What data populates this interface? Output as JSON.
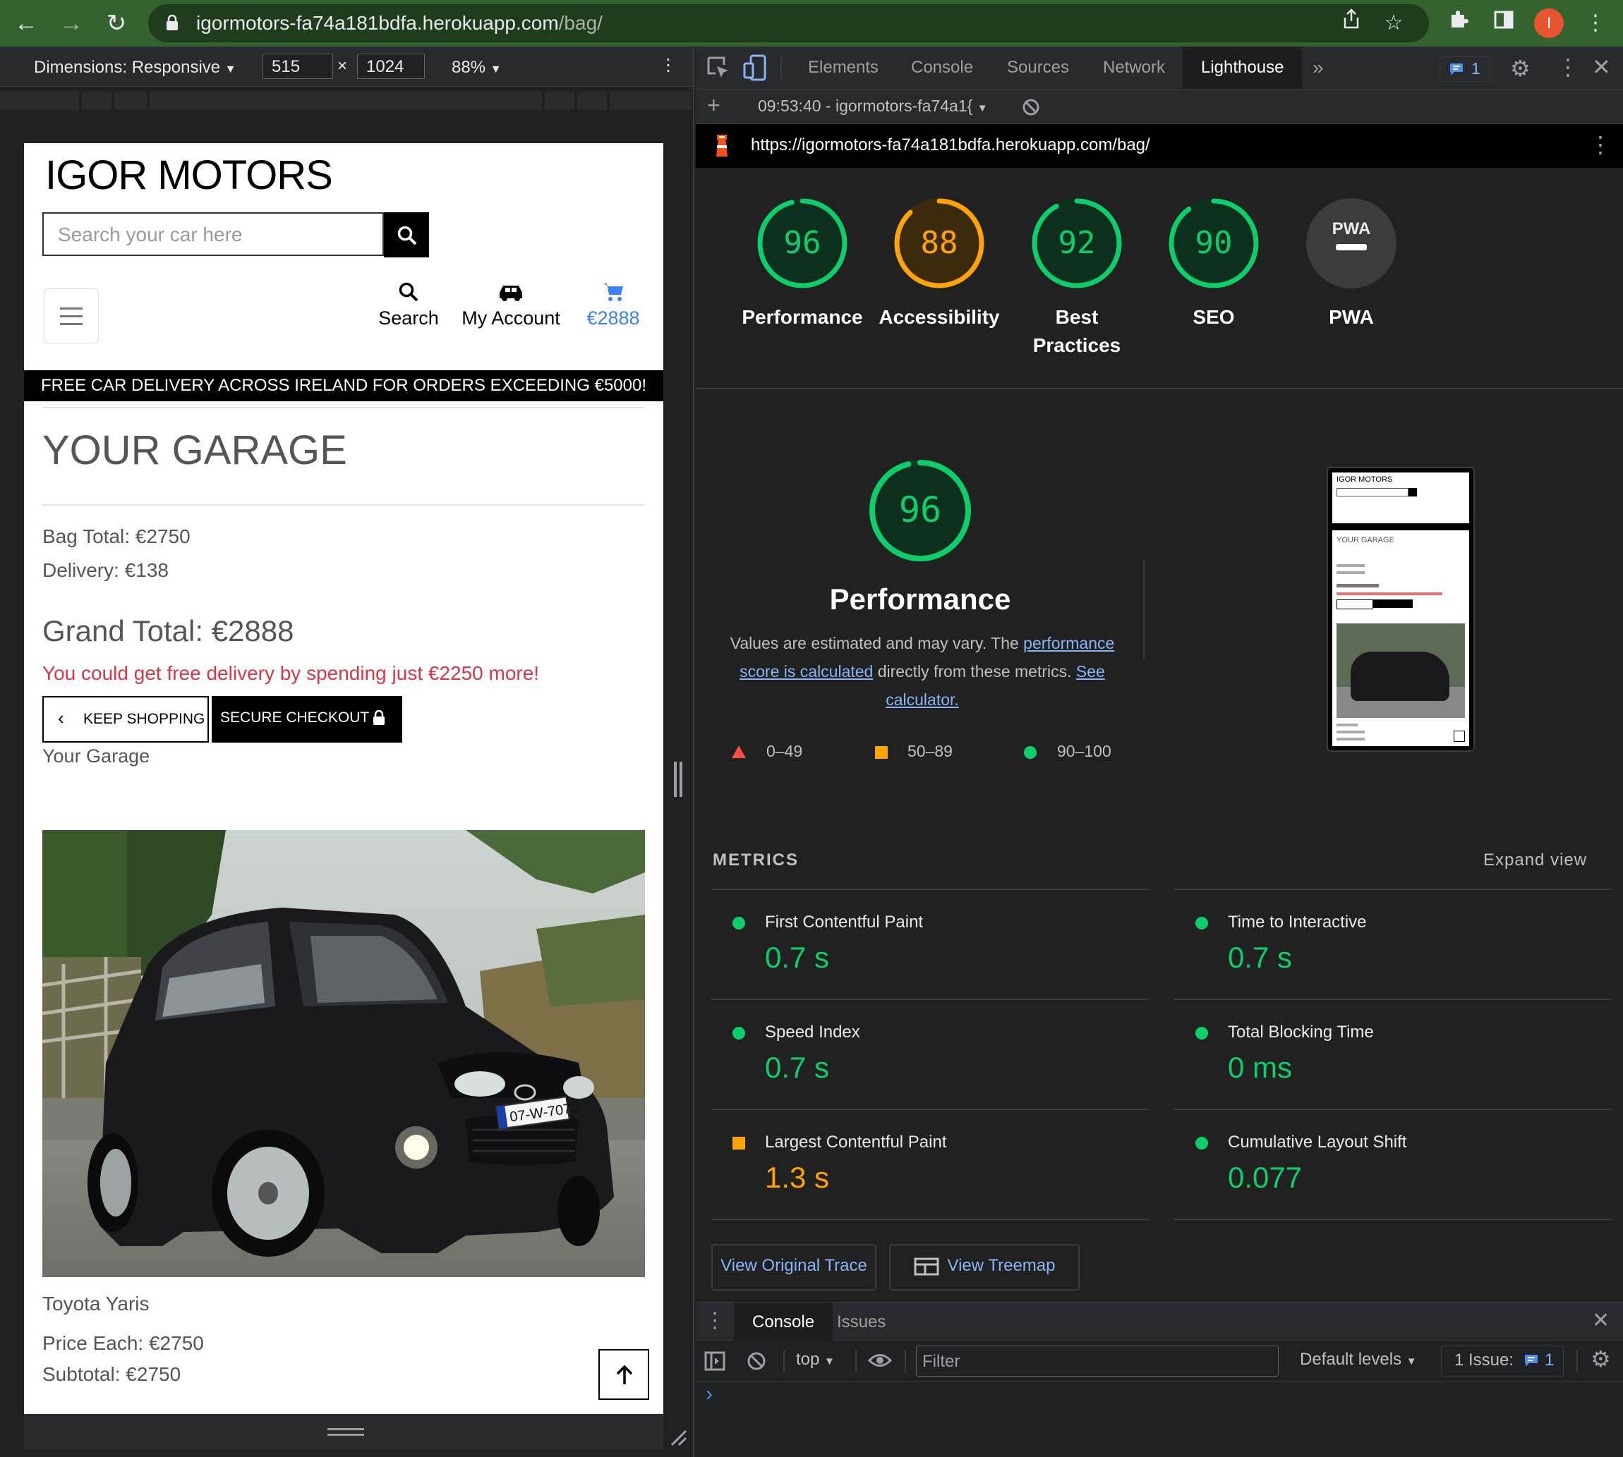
{
  "browser": {
    "url_host": "igormotors-fa74a181bdfa.herokuapp.com",
    "url_path": "/bag/",
    "profile_initial": "I"
  },
  "device_toolbar": {
    "dimensions_label": "Dimensions: Responsive",
    "width": "515",
    "times": "×",
    "height": "1024",
    "zoom": "88%"
  },
  "site": {
    "brand": "IGOR MOTORS",
    "search_placeholder": "Search your car here",
    "nav": {
      "search": "Search",
      "account": "My Account",
      "cart": "€2888"
    },
    "banner": "FREE CAR DELIVERY ACROSS IRELAND FOR ORDERS EXCEEDING €5000!",
    "heading": "YOUR GARAGE",
    "bag_total": "Bag Total: €2750",
    "delivery": "Delivery: €138",
    "grand_total": "Grand Total: €2888",
    "free_delivery_msg": "You could get free delivery by spending just €2250 more!",
    "keep_shopping": "KEEP SHOPPING",
    "secure_checkout": "SECURE CHECKOUT",
    "garage_label": "Your Garage",
    "product_name": "Toyota Yaris",
    "price_each": "Price Each: €2750",
    "subtotal": "Subtotal: €2750",
    "plate_text": "07-W-7072"
  },
  "devtools": {
    "tabs": [
      "Elements",
      "Console",
      "Sources",
      "Network",
      "Lighthouse"
    ],
    "active_tab": "Lighthouse",
    "more_tabs": "»",
    "issues_count": "1",
    "report_selector": "09:53:40 - igormotors-fa74a1{",
    "report_url": "https://igormotors-fa74a181bdfa.herokuapp.com/bag/"
  },
  "lighthouse": {
    "gauges": [
      {
        "score": "96",
        "label_lines": [
          "Performance"
        ],
        "value": 96,
        "color": "#0cce6b"
      },
      {
        "score": "88",
        "label_lines": [
          "Accessibility"
        ],
        "value": 88,
        "color": "#ffa400"
      },
      {
        "score": "92",
        "label_lines": [
          "Best",
          "Practices"
        ],
        "value": 92,
        "color": "#0cce6b"
      },
      {
        "score": "90",
        "label_lines": [
          "SEO"
        ],
        "value": 90,
        "color": "#0cce6b"
      },
      {
        "score": "PWA",
        "label_lines": [
          "PWA"
        ],
        "value": 0,
        "color": "#9aa0a6"
      }
    ],
    "perf_score": "96",
    "perf_title": "Performance",
    "desc_1": "Values are estimated and may vary. The",
    "desc_link_1": "performance score is calculated",
    "desc_2": "directly from these metrics.",
    "desc_link_2": "See calculator.",
    "legend": [
      "0–49",
      "50–89",
      "90–100"
    ],
    "metrics_title": "METRICS",
    "expand_view": "Expand view",
    "metrics": [
      {
        "name": "First Contentful Paint",
        "value": "0.7 s",
        "status": "pass"
      },
      {
        "name": "Time to Interactive",
        "value": "0.7 s",
        "status": "pass"
      },
      {
        "name": "Speed Index",
        "value": "0.7 s",
        "status": "pass"
      },
      {
        "name": "Total Blocking Time",
        "value": "0 ms",
        "status": "pass"
      },
      {
        "name": "Largest Contentful Paint",
        "value": "1.3 s",
        "status": "average"
      },
      {
        "name": "Cumulative Layout Shift",
        "value": "0.077",
        "status": "pass"
      }
    ],
    "view_trace": "View Original Trace",
    "view_treemap": "View Treemap",
    "thumb": {
      "brand": "IGOR MOTORS",
      "heading": "YOUR GARAGE"
    }
  },
  "console": {
    "tabs": [
      "Console",
      "Issues"
    ],
    "context": "top",
    "filter_placeholder": "Filter",
    "levels": "Default levels",
    "issue_label": "1 Issue:",
    "issue_count": "1",
    "prompt": "›"
  },
  "colors": {
    "pass": "#0cce6b",
    "average": "#ffa400",
    "fail": "#ff4e42",
    "link_blue": "#8ab4f8",
    "site_red": "#dc3545",
    "site_cart_blue": "#3b82f6"
  }
}
